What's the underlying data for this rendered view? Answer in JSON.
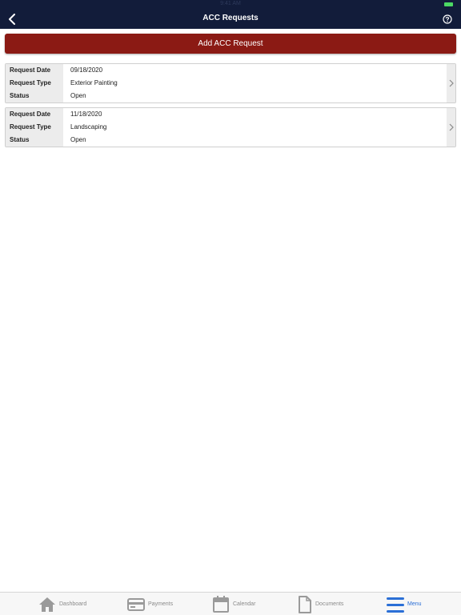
{
  "status_bar": {
    "time": "9:41 AM"
  },
  "nav": {
    "title": "ACC Requests",
    "back_icon": "chevron-left-icon",
    "help_icon": "question-circle-icon"
  },
  "actions": {
    "add_label": "Add ACC Request"
  },
  "colors": {
    "nav_bg": "#121c3a",
    "button_bg": "#8b1a14",
    "active_tab": "#2b6fd6"
  },
  "requests": [
    {
      "date_label": "Request Date",
      "date": "09/18/2020",
      "type_label": "Request Type",
      "type": "Exterior Painting",
      "status_label": "Status",
      "status": "Open"
    },
    {
      "date_label": "Request Date",
      "date": "11/18/2020",
      "type_label": "Request Type",
      "type": "Landscaping",
      "status_label": "Status",
      "status": "Open"
    }
  ],
  "tabs": [
    {
      "label": "Dashboard",
      "icon": "home-icon"
    },
    {
      "label": "Payments",
      "icon": "credit-card-icon"
    },
    {
      "label": "Calendar",
      "icon": "calendar-icon"
    },
    {
      "label": "Documents",
      "icon": "document-icon"
    },
    {
      "label": "Menu",
      "icon": "hamburger-menu-icon",
      "active": true
    }
  ]
}
